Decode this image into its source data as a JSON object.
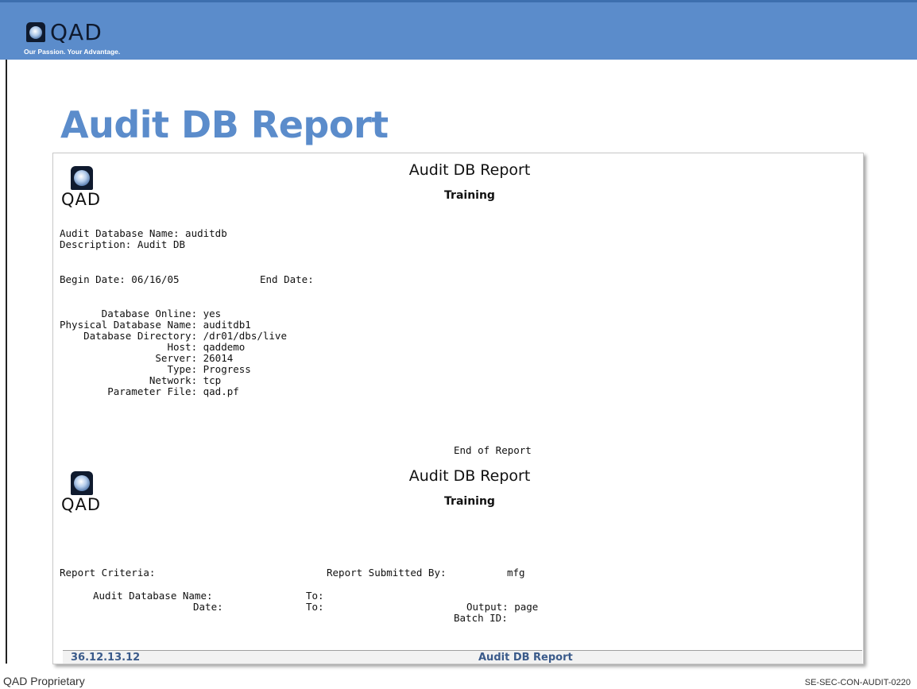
{
  "brand": {
    "name": "QAD",
    "tagline": "Our Passion. Your Advantage."
  },
  "slide": {
    "title": "Audit DB Report"
  },
  "report": {
    "page1": {
      "logo_text": "QAD",
      "title": "Audit DB Report",
      "subtitle": "Training",
      "db_name_line": "Audit Database Name: auditdb",
      "description_line": "Description: Audit DB",
      "begin_date_line": "Begin Date: 06/16/05",
      "end_date_line": "End Date:",
      "details": [
        "       Database Online: yes",
        "Physical Database Name: auditdb1",
        "    Database Directory: /dr01/dbs/live",
        "                  Host: qaddemo",
        "                Server: 26014",
        "                  Type: Progress",
        "               Network: tcp",
        "        Parameter File: qad.pf"
      ],
      "end_of_report": "End of Report"
    },
    "page2": {
      "logo_text": "QAD",
      "title": "Audit DB Report",
      "subtitle": "Training",
      "criteria_label": "Report Criteria:",
      "submitted_by_label": "Report Submitted By:",
      "submitted_by_value": "mfg",
      "audit_db_name_label": "Audit Database Name:",
      "date_label": "Date:",
      "to_label_1": "To:",
      "to_label_2": "To:",
      "output_line": "Output: page",
      "batch_line": "Batch ID:"
    },
    "footer": {
      "left": "36.12.13.12",
      "right": "Audit DB Report"
    }
  },
  "page_footer": {
    "left": "QAD Proprietary",
    "right": "SE-SEC-CON-AUDIT-0220"
  },
  "colors": {
    "header": "#5b8ccb",
    "title": "#5b8ccb",
    "footer_text": "#3a5a8a"
  }
}
